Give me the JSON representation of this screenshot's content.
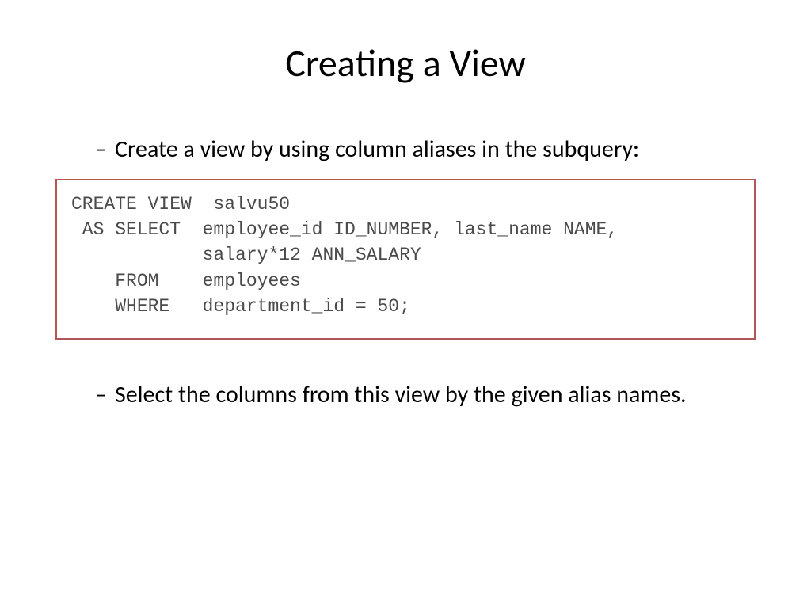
{
  "slide": {
    "title": "Creating a View",
    "bullet1": "Create a view by using column aliases in the subquery:",
    "code": "CREATE VIEW  salvu50\n AS SELECT  employee_id ID_NUMBER, last_name NAME,\n            salary*12 ANN_SALARY\n    FROM    employees\n    WHERE   department_id = 50;",
    "bullet2": "Select the columns from this view by the given alias names."
  }
}
